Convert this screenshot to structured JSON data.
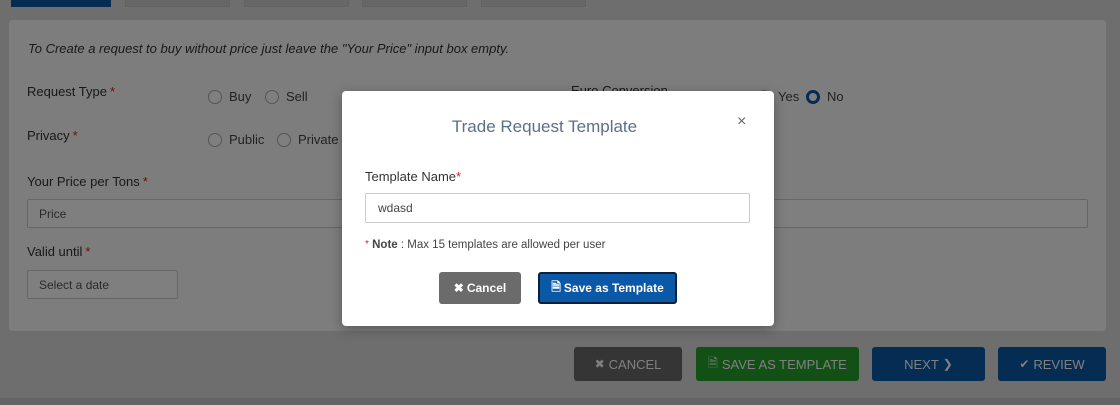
{
  "form": {
    "info_text": "To Create a request to buy without price just leave the \"Your Price\" input box empty.",
    "request_type": {
      "label": "Request Type",
      "required": "*",
      "options": [
        "Buy",
        "Sell"
      ]
    },
    "privacy": {
      "label": "Privacy",
      "required": "*",
      "options": [
        "Public",
        "Private"
      ]
    },
    "euro_conversion": {
      "label": "Euro Conversion",
      "options": [
        "Yes",
        "No"
      ],
      "selected": "No"
    },
    "price": {
      "label": "Your Price per Tons",
      "required": "*",
      "placeholder": "Price"
    },
    "valid_until": {
      "label": "Valid until",
      "required": "*",
      "placeholder": "Select a date"
    }
  },
  "footer": {
    "cancel_label": "CANCEL",
    "save_template_label": "SAVE AS TEMPLATE",
    "next_label": "NEXT",
    "review_label": "REVIEW"
  },
  "modal": {
    "title": "Trade Request Template",
    "close_glyph": "×",
    "template_name_label": "Template Name",
    "required": "*",
    "template_name_value": "wdasd",
    "note_star": "*",
    "note_label": "Note",
    "note_text": " : Max 15 templates are allowed per user",
    "cancel_label": "Cancel",
    "save_label": "Save as Template"
  },
  "icons": {
    "times": "times-icon",
    "file": "file-icon",
    "chevron": "chevron-right-icon",
    "check": "check-icon"
  },
  "colors": {
    "primary": "#0a58a6",
    "success": "#24a12d",
    "secondary": "#6b6b6b",
    "required": "#d22222"
  }
}
